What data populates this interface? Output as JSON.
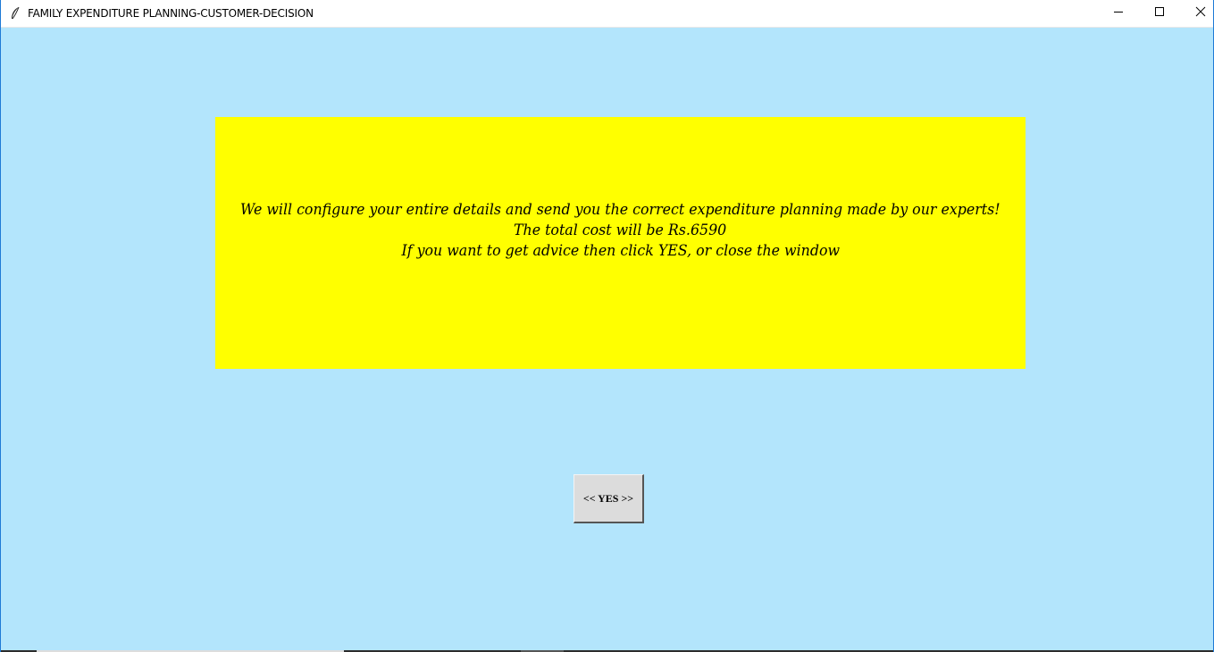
{
  "window": {
    "title": "FAMILY EXPENDITURE PLANNING-CUSTOMER-DECISION",
    "icon": "feather-icon",
    "controls": {
      "minimize_icon": "minimize-icon",
      "maximize_icon": "maximize-icon",
      "close_icon": "close-icon"
    },
    "background_color": "#b3e5fc"
  },
  "message": {
    "background_color": "#ffff00",
    "lines": [
      "We will configure your entire details and send you the correct expenditure planning made by our experts!",
      "The total cost will be Rs.6590",
      "If you want to get advice then click YES, or close the window"
    ]
  },
  "yes_button": {
    "label": "<< YES >>"
  }
}
